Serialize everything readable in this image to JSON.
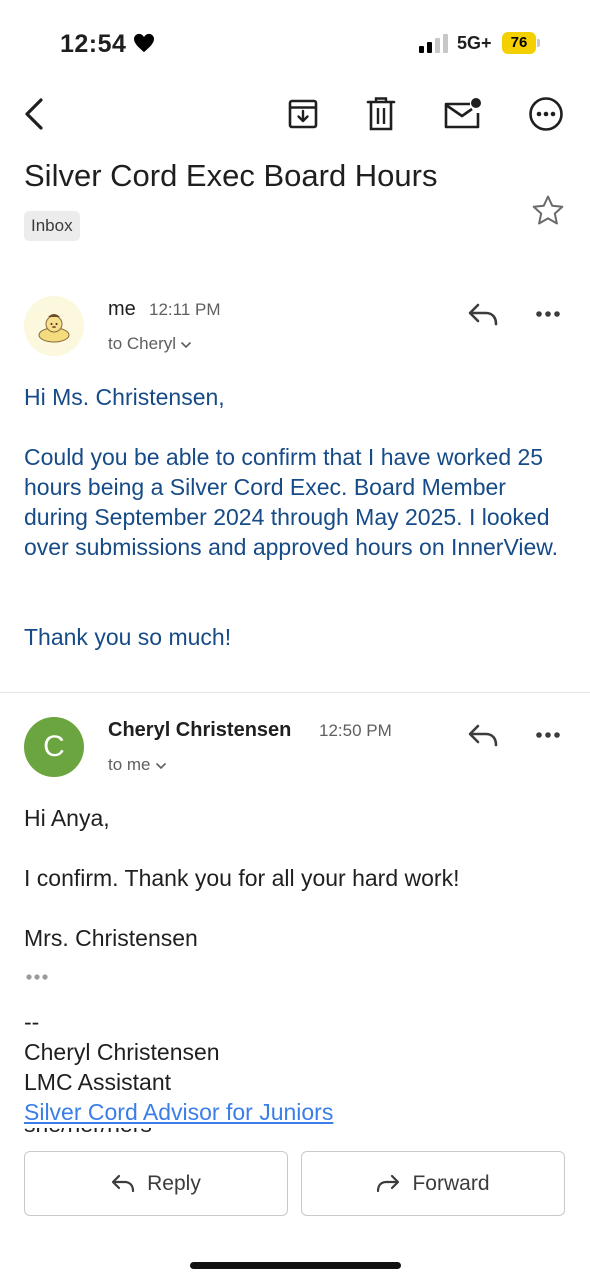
{
  "status_bar": {
    "time": "12:54",
    "network": "5G+",
    "battery": "76"
  },
  "toolbar": {
    "back_icon": "back-arrow-icon",
    "archive_icon": "archive-icon",
    "delete_icon": "trash-icon",
    "unread_icon": "mark-unread-icon",
    "more_icon": "more-horizontal-icon"
  },
  "email": {
    "subject": "Silver Cord Exec Board Hours",
    "label": "Inbox"
  },
  "messages": [
    {
      "sender": "me",
      "time": "12:11 PM",
      "to": "to Cheryl",
      "body": [
        "Hi Ms. Christensen,",
        "Could you be able to confirm that I have worked 25 hours being a Silver Cord Exec. Board Member during September 2024 through May 2025. I looked over submissions and approved hours on InnerView.",
        "Thank you so much!"
      ]
    },
    {
      "sender": "Cheryl Christensen",
      "avatar_letter": "C",
      "time": "12:50 PM",
      "to": "to me",
      "body": [
        "Hi Anya,",
        "I confirm.  Thank you for all your hard work!",
        "Mrs. Christensen"
      ],
      "signature": {
        "separator": "--",
        "name": "Cheryl Christensen",
        "title": "LMC Assistant",
        "link": "Silver Cord Advisor for Juniors",
        "pronouns": "she/her/hers"
      }
    }
  ],
  "actions": {
    "reply": "Reply",
    "forward": "Forward"
  },
  "colors": {
    "battery": "#f5d000",
    "avatar_c": "#6ba53f",
    "body_blue": "#164b87",
    "link": "#3b7ee8"
  }
}
